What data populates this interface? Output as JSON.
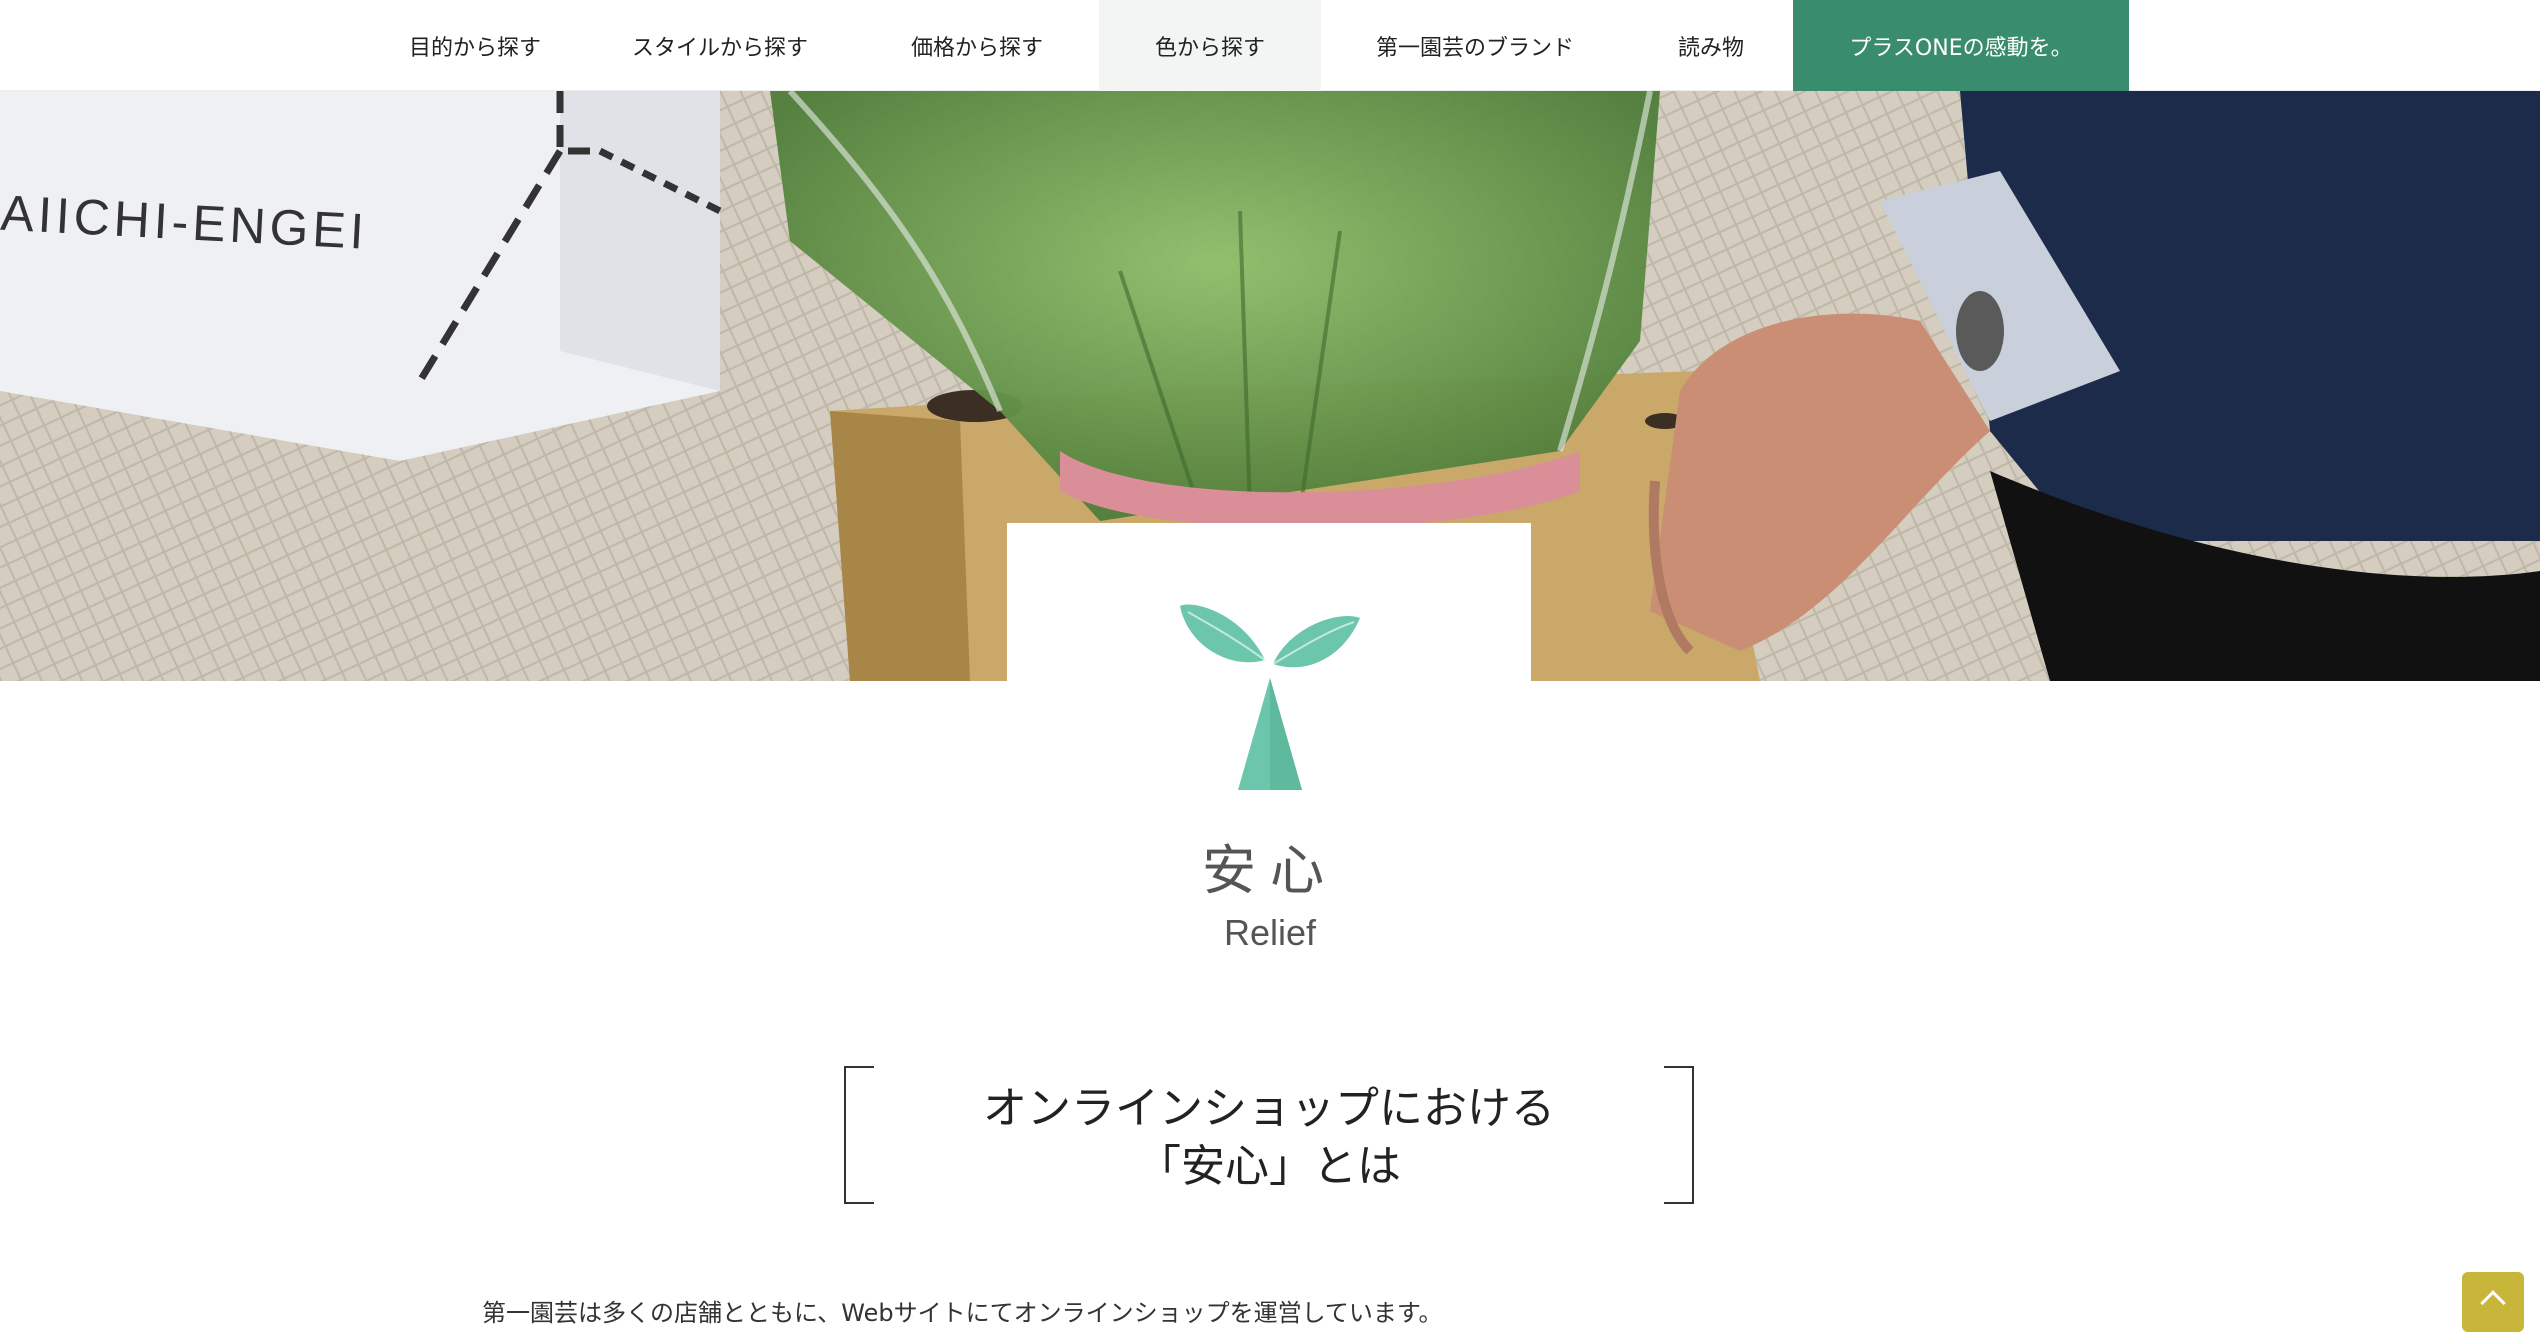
{
  "nav": {
    "items": [
      {
        "label": "目的から探す"
      },
      {
        "label": "スタイルから探す"
      },
      {
        "label": "価格から探す"
      },
      {
        "label": "色から探す"
      },
      {
        "label": "第一園芸のブランド"
      },
      {
        "label": "読み物"
      },
      {
        "label": "プラスONEの感動を。"
      }
    ]
  },
  "hero": {
    "box_brand": "AIICHI-ENGEI"
  },
  "section": {
    "title_ja": "安心",
    "title_en": "Relief",
    "heading_line1": "オンラインショップにおける",
    "heading_line2": "「安心」とは",
    "body_text": "第一園芸は多くの店舗とともに、Webサイトにてオンラインショップを運営しています。"
  },
  "colors": {
    "accent_green": "#3a8c6e",
    "sprout": "#6cc6ab",
    "back_to_top": "#c8b63a"
  },
  "icons": {
    "sprout": "sprout-icon",
    "back_to_top": "chevron-up-icon"
  }
}
